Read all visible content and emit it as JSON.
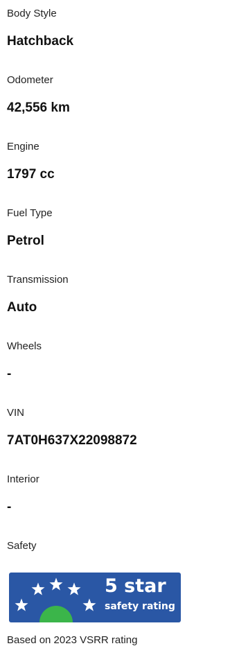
{
  "specs": [
    {
      "label": "Body Style",
      "value": "Hatchback"
    },
    {
      "label": "Odometer",
      "value": "42,556 km"
    },
    {
      "label": "Engine",
      "value": "1797 cc"
    },
    {
      "label": "Fuel Type",
      "value": "Petrol"
    },
    {
      "label": "Transmission",
      "value": "Auto"
    },
    {
      "label": "Wheels",
      "value": "-"
    },
    {
      "label": "VIN",
      "value": "7AT0H637X22098872"
    },
    {
      "label": "Interior",
      "value": "-"
    }
  ],
  "safety": {
    "label": "Safety",
    "badge_rating_text": "5 star",
    "badge_sub_text": "safety rating",
    "stars": 5,
    "badge_color": "#2a57a5",
    "star_color": "#ffffff",
    "dome_color": "#3bb54a",
    "note": "Based on 2023 VSRR rating"
  }
}
